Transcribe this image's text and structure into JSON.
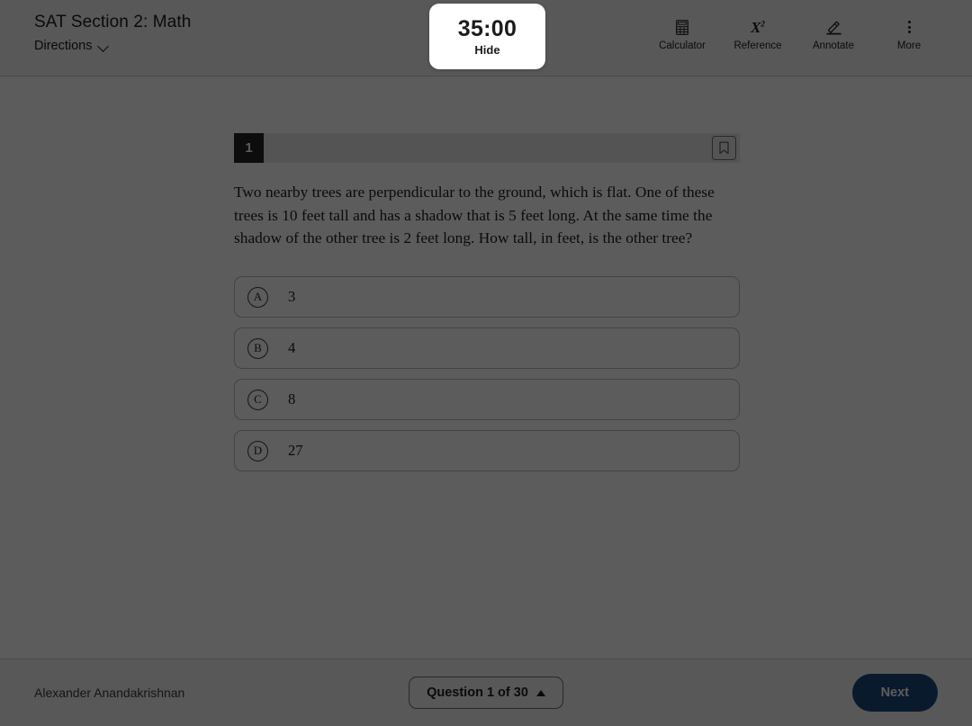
{
  "header": {
    "section_title": "SAT Section 2: Math",
    "directions_label": "Directions",
    "directions_icon": "chevron-down-icon",
    "tools": [
      {
        "label": "Calculator",
        "icon": "calculator-icon"
      },
      {
        "label": "Reference",
        "icon": "superscript-x-squared-icon"
      },
      {
        "label": "Annotate",
        "icon": "pen-underline-icon"
      },
      {
        "label": "More",
        "icon": "more-vertical-dots-icon"
      }
    ]
  },
  "timer": {
    "time_remaining": "35:00",
    "hide_label": "Hide"
  },
  "question": {
    "number": "1",
    "bookmark_icon": "bookmark-icon",
    "text": "Two nearby trees are perpendicular to the ground, which is flat. One of these trees is 10 feet tall and has a shadow that is 5 feet long. At the same time the shadow of the other tree is 2 feet long. How tall, in feet, is the other tree?",
    "choices": [
      {
        "letter": "A",
        "text": "3"
      },
      {
        "letter": "B",
        "text": "4"
      },
      {
        "letter": "C",
        "text": "8"
      },
      {
        "letter": "D",
        "text": "27"
      }
    ]
  },
  "footer": {
    "student_name": "Alexander Anandakrishnan",
    "question_nav_label": "Question 1 of 30",
    "question_nav_icon": "triangle-up-icon",
    "next_label": "Next"
  },
  "colors": {
    "next_button": "#1b4a7d",
    "question_badge": "#262626",
    "overlay": "rgba(0,0,0,0.64)",
    "header_bg": "#f4f4f4"
  }
}
